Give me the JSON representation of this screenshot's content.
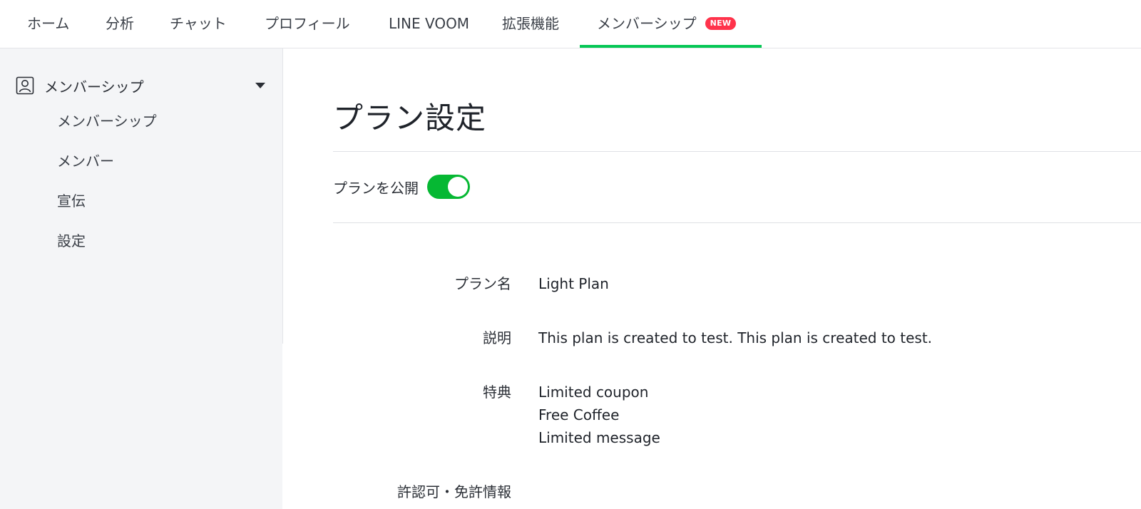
{
  "topnav": {
    "tabs": [
      {
        "label": "ホーム"
      },
      {
        "label": "分析"
      },
      {
        "label": "チャット"
      },
      {
        "label": "プロフィール"
      },
      {
        "label": "LINE VOOM"
      },
      {
        "label": "拡張機能"
      },
      {
        "label": "メンバーシップ",
        "badge": "NEW",
        "active": true
      }
    ]
  },
  "sidebar": {
    "section_label": "メンバーシップ",
    "section_icon": "person-card-icon",
    "items": [
      {
        "label": "メンバーシップ"
      },
      {
        "label": "メンバー"
      },
      {
        "label": "宣伝"
      },
      {
        "label": "設定"
      }
    ]
  },
  "main": {
    "title": "プラン設定",
    "publish_label": "プランを公開",
    "publish_on": true,
    "fields": {
      "plan_name_label": "プラン名",
      "plan_name_value": "Light Plan",
      "description_label": "説明",
      "description_value": "This plan is created to test. This plan is created to test.",
      "benefits_label": "特典",
      "benefits": [
        "Limited coupon",
        "Free Coffee",
        "Limited message"
      ],
      "license_label": "許認可・免許情報"
    }
  },
  "colors": {
    "accent_green": "#06c755",
    "toggle_green": "#06b833",
    "badge_red": "#ff334b",
    "sidebar_bg": "#f4f5f7"
  }
}
